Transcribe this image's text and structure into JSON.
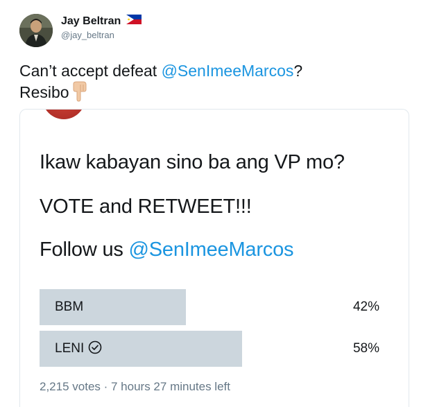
{
  "author": {
    "display_name": "Jay Beltran",
    "handle": "@jay_beltran",
    "flag_icon": "philippines-flag-icon",
    "avatar_icon": "user-avatar"
  },
  "tweet": {
    "text_before": "Can’t accept defeat ",
    "mention": "@SenImeeMarcos",
    "text_after": "?",
    "line2": "Resibo",
    "emoji_icon": "backhand-index-pointing-down-icon"
  },
  "quoted_image": {
    "line1": "Ikaw kabayan sino ba ang VP mo?",
    "line2": "VOTE and RETWEET!!!",
    "line3_prefix": "Follow us ",
    "line3_mention": "@SenImeeMarcos",
    "poll": {
      "options": [
        {
          "label": "BBM",
          "percent_text": "42%",
          "percent": 42,
          "winner": false
        },
        {
          "label": "LENI",
          "percent_text": "58%",
          "percent": 58,
          "winner": true
        }
      ],
      "meta": "2,215 votes · 7 hours 27 minutes left",
      "winner_icon": "check-circle-icon"
    }
  },
  "colors": {
    "text": "#14171a",
    "link": "#1b95e0",
    "muted": "#657786",
    "poll_bar": "#ccd6dd",
    "card_border": "#e1e8ed"
  }
}
